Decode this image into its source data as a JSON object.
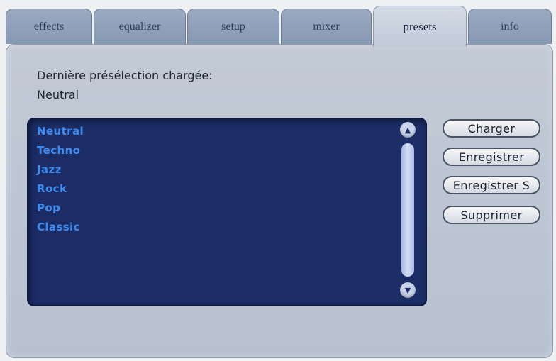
{
  "tabs": [
    {
      "label": "effects"
    },
    {
      "label": "equalizer"
    },
    {
      "label": "setup"
    },
    {
      "label": "mixer"
    },
    {
      "label": "presets",
      "active": true
    },
    {
      "label": "info"
    }
  ],
  "presets": {
    "last_loaded_label": "Dernière présélection chargée:",
    "last_loaded_value": "Neutral",
    "items": [
      "Neutral",
      "Techno",
      "Jazz",
      "Rock",
      "Pop",
      "Classic"
    ],
    "buttons": {
      "load": "Charger",
      "save": "Enregistrer",
      "save_as": "Enregistrer S",
      "delete": "Supprimer"
    }
  },
  "colors": {
    "list_background": "#1c2d66",
    "list_text": "#3d8bf0",
    "panel": "#bfc7d4"
  },
  "icons": {
    "scroll_up": "chevron-up-icon",
    "scroll_down": "chevron-down-icon"
  }
}
